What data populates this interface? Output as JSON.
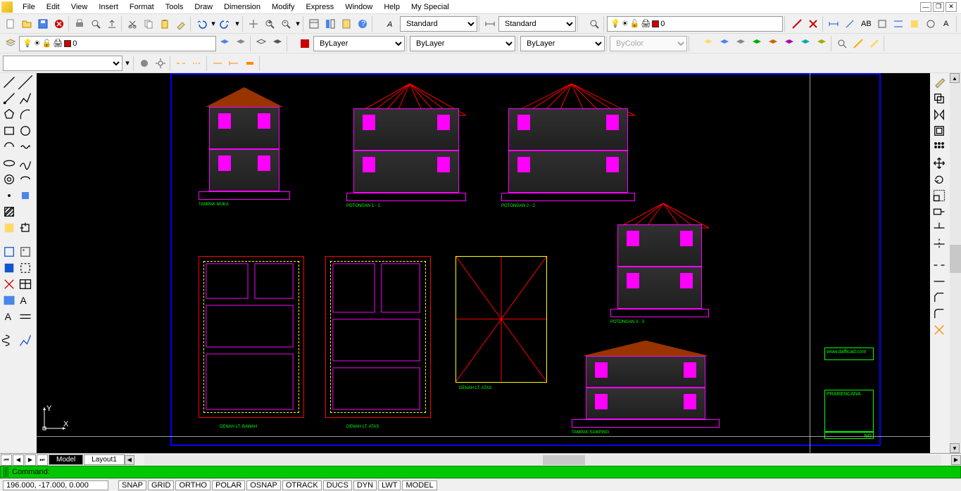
{
  "menu": {
    "items": [
      "File",
      "Edit",
      "View",
      "Insert",
      "Format",
      "Tools",
      "Draw",
      "Dimension",
      "Modify",
      "Express",
      "Window",
      "Help",
      "My Special"
    ]
  },
  "toolbar": {
    "text_style": "Standard",
    "dim_style": "Standard",
    "layer_current": "0",
    "color": "ByLayer",
    "linetype": "ByLayer",
    "lineweight": "ByLayer",
    "plotstyle": "ByColor"
  },
  "tabs": {
    "items": [
      "Model",
      "Layout1"
    ],
    "active": 0
  },
  "command": {
    "prompt": "Command:"
  },
  "status": {
    "coords": "196.000, -17.000, 0.000",
    "toggles": [
      "SNAP",
      "GRID",
      "ORTHO",
      "POLAR",
      "OSNAP",
      "OTRACK",
      "DUCS",
      "DYN",
      "LWT",
      "MODEL"
    ]
  },
  "drawing": {
    "labels": {
      "elev1": "TAMPAK MUKA",
      "sect1": "POTONGAN 1 - 1",
      "sect2": "POTONGAN 2 - 2",
      "sect3": "POTONGAN 3 - 3",
      "plan1": "DENAH LT. BAWAH",
      "plan2": "DENAH LT. ATAS",
      "plan3": "DENAH LT. ATAS",
      "elev2": "TAMPAK SAMPING",
      "website": "www.dafficad.com",
      "title": "PRARENCANA",
      "no": "NO"
    }
  }
}
